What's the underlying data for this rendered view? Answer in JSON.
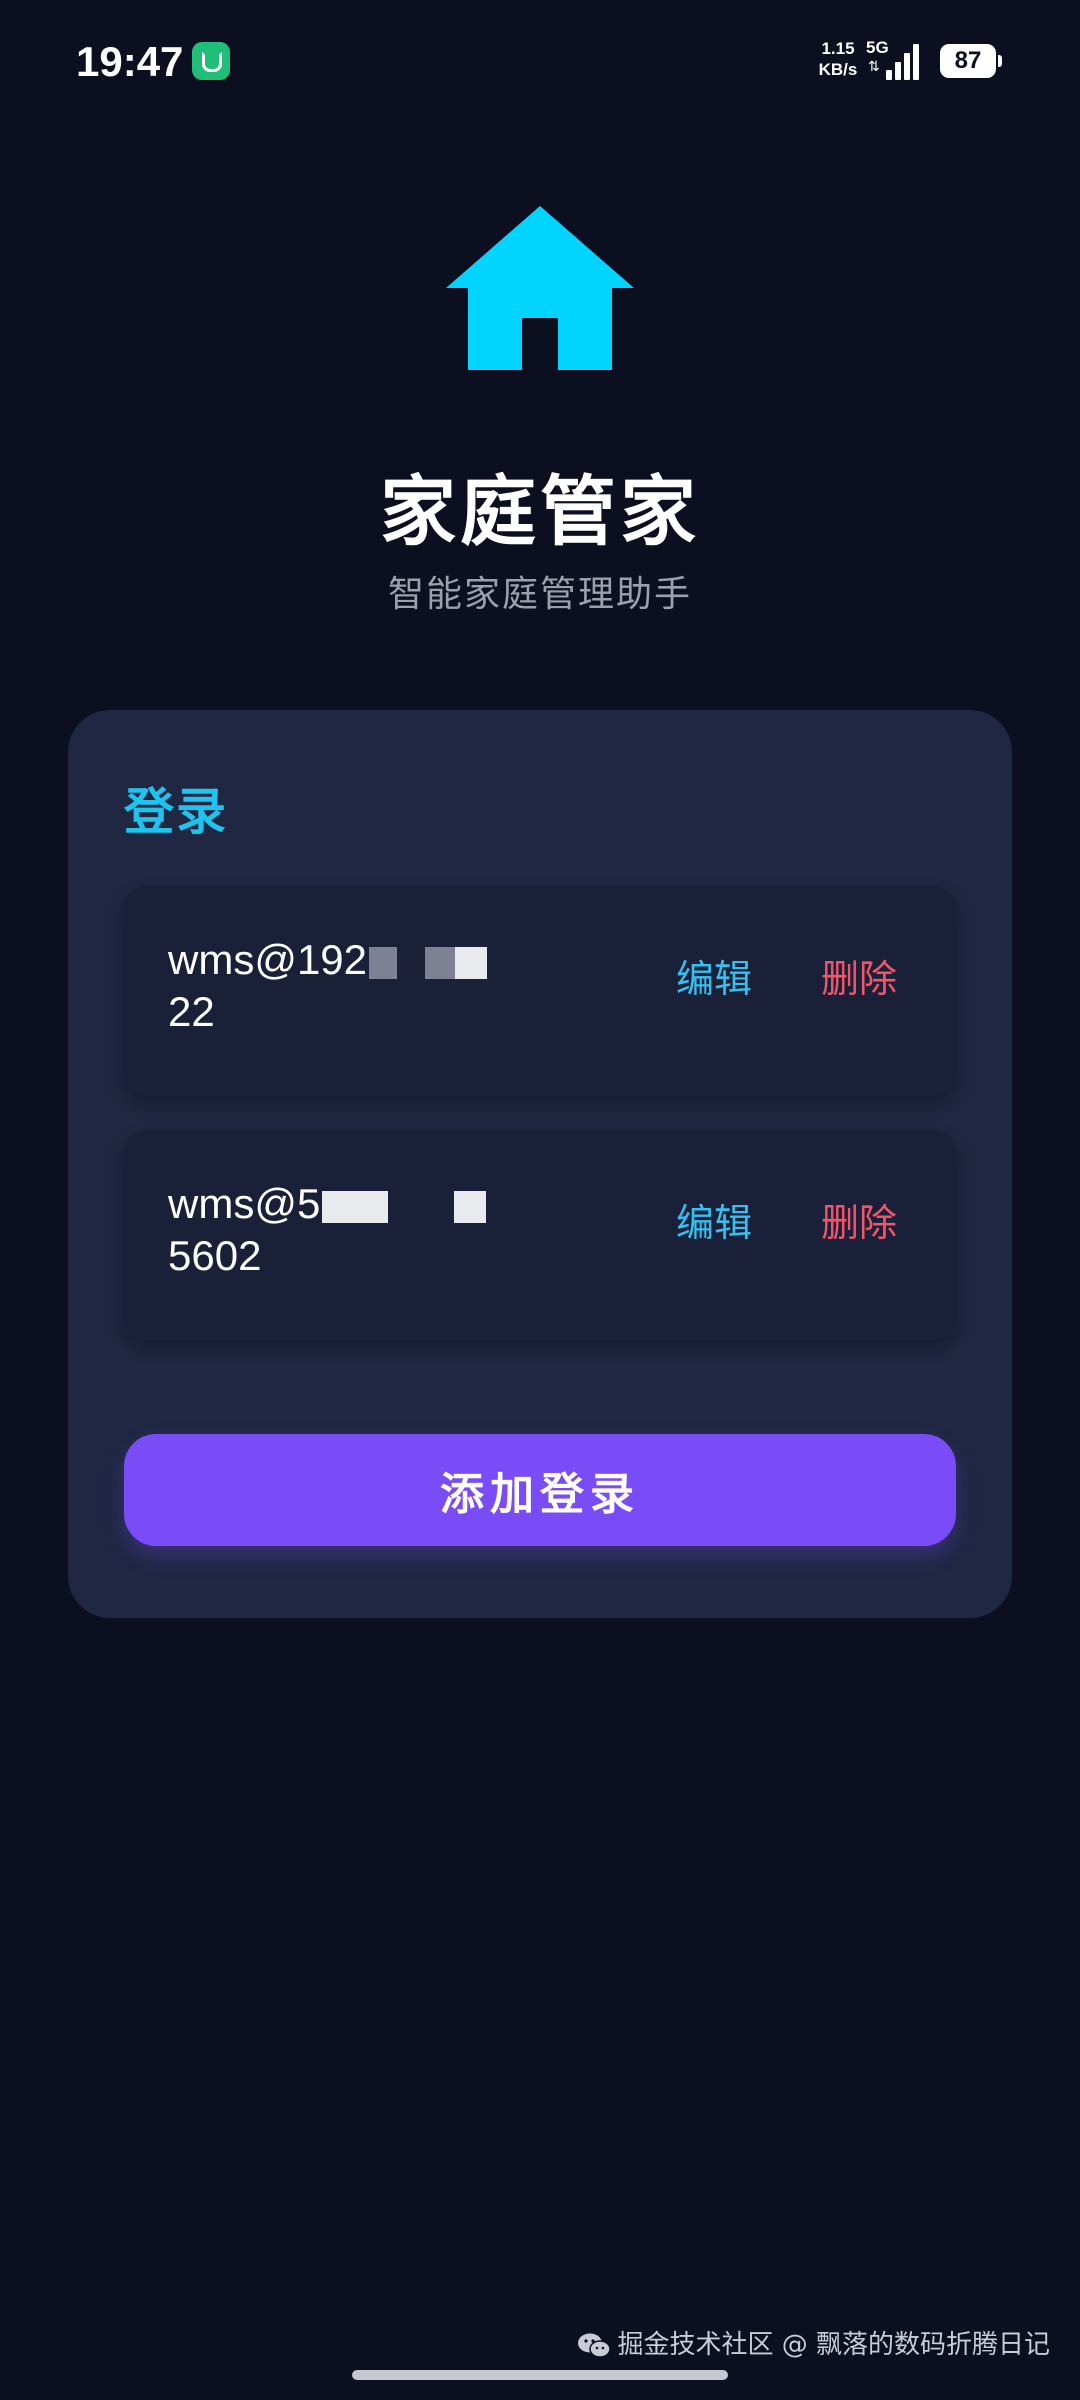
{
  "status_bar": {
    "time": "19:47",
    "speed": "1.15 KB/s",
    "network": "5G",
    "battery": "87"
  },
  "header": {
    "icon": "home-icon",
    "title": "家庭管家",
    "subtitle": "智能家庭管理助手"
  },
  "card": {
    "heading": "登录",
    "logins": [
      {
        "line1": "wms@192",
        "line2": "22",
        "edit_label": "编辑",
        "delete_label": "删除"
      },
      {
        "line1": "wms@5",
        "line2": "5602",
        "edit_label": "编辑",
        "delete_label": "删除"
      }
    ],
    "add_button_label": "添加登录"
  },
  "watermark": {
    "icon": "wechat-icon",
    "text": "掘金技术社区 @ 飘落的数码折腾日记"
  },
  "colors": {
    "background": "#0b0f1f",
    "card": "#1f2742",
    "accent": "#1ec3ee",
    "edit": "#36bff0",
    "delete": "#f05569",
    "primary_button": "#7a4cf7"
  }
}
